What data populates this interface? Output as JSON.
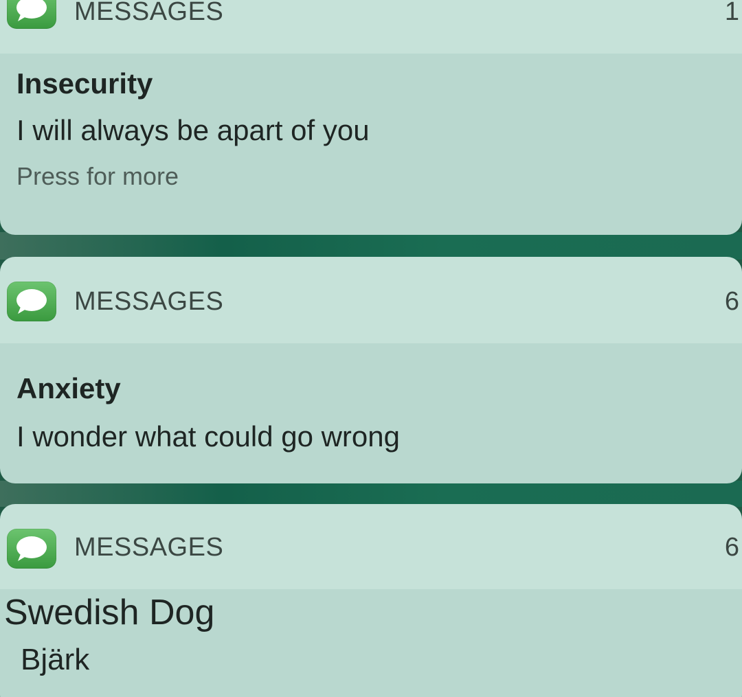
{
  "notifications": [
    {
      "app": "MESSAGES",
      "count": "1",
      "sender": "Insecurity",
      "message": "I will always be apart of you",
      "hint": "Press for more"
    },
    {
      "app": "MESSAGES",
      "count": "6",
      "sender": "Anxiety",
      "message": "I wonder what could go wrong"
    },
    {
      "app": "MESSAGES",
      "count": "6",
      "sender": "Swedish Dog",
      "message": "Bjärk"
    }
  ],
  "icons": {
    "app_icon": "messages-bubble-icon"
  },
  "colors": {
    "card_header": "#c6e2d9",
    "card_body": "#b9d8cf",
    "background": "#1f5a45",
    "icon_green": "#4caf50"
  }
}
